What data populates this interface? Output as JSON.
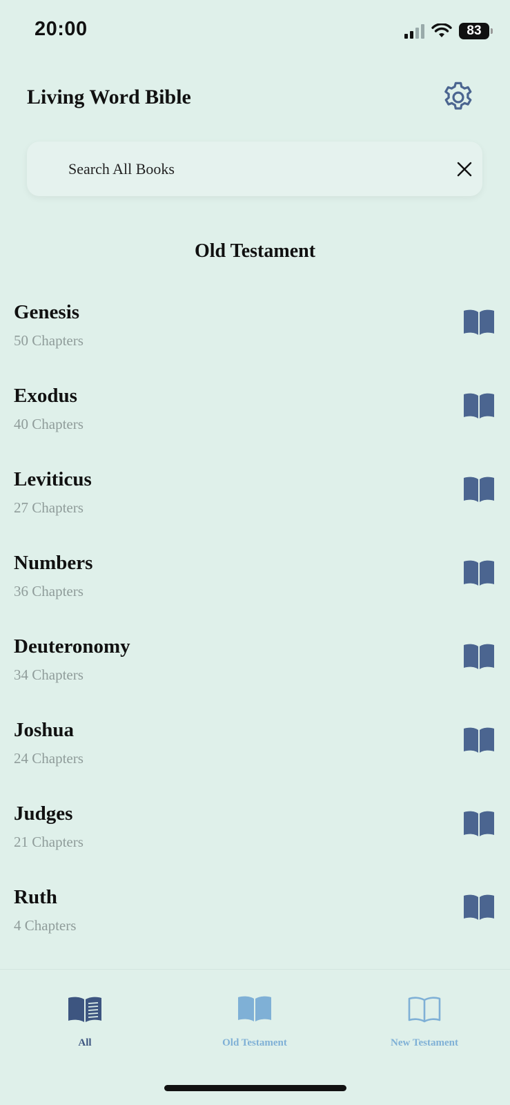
{
  "status_bar": {
    "time": "20:00",
    "battery": "83"
  },
  "header": {
    "title": "Living Word Bible",
    "settings_icon": "gear-icon"
  },
  "search": {
    "text": "Search All Books",
    "clear_icon": "close-icon"
  },
  "section": {
    "title": "Old Testament"
  },
  "books": [
    {
      "name": "Genesis",
      "chapters": "50 Chapters"
    },
    {
      "name": "Exodus",
      "chapters": "40 Chapters"
    },
    {
      "name": "Leviticus",
      "chapters": "27 Chapters"
    },
    {
      "name": "Numbers",
      "chapters": "36 Chapters"
    },
    {
      "name": "Deuteronomy",
      "chapters": "34 Chapters"
    },
    {
      "name": "Joshua",
      "chapters": "24 Chapters"
    },
    {
      "name": "Judges",
      "chapters": "21 Chapters"
    },
    {
      "name": "Ruth",
      "chapters": "4 Chapters"
    }
  ],
  "tabs": [
    {
      "label": "All",
      "icon": "book-text-icon",
      "active": true
    },
    {
      "label": "Old Testament",
      "icon": "book-filled-icon",
      "active": false
    },
    {
      "label": "New Testament",
      "icon": "book-outline-icon",
      "active": false
    }
  ],
  "colors": {
    "background": "#dff0ea",
    "book_icon": "#4b6590",
    "tab_active": "#3d5580",
    "tab_inactive": "#7fb0d6",
    "chapter_text": "#8f9c9a"
  }
}
